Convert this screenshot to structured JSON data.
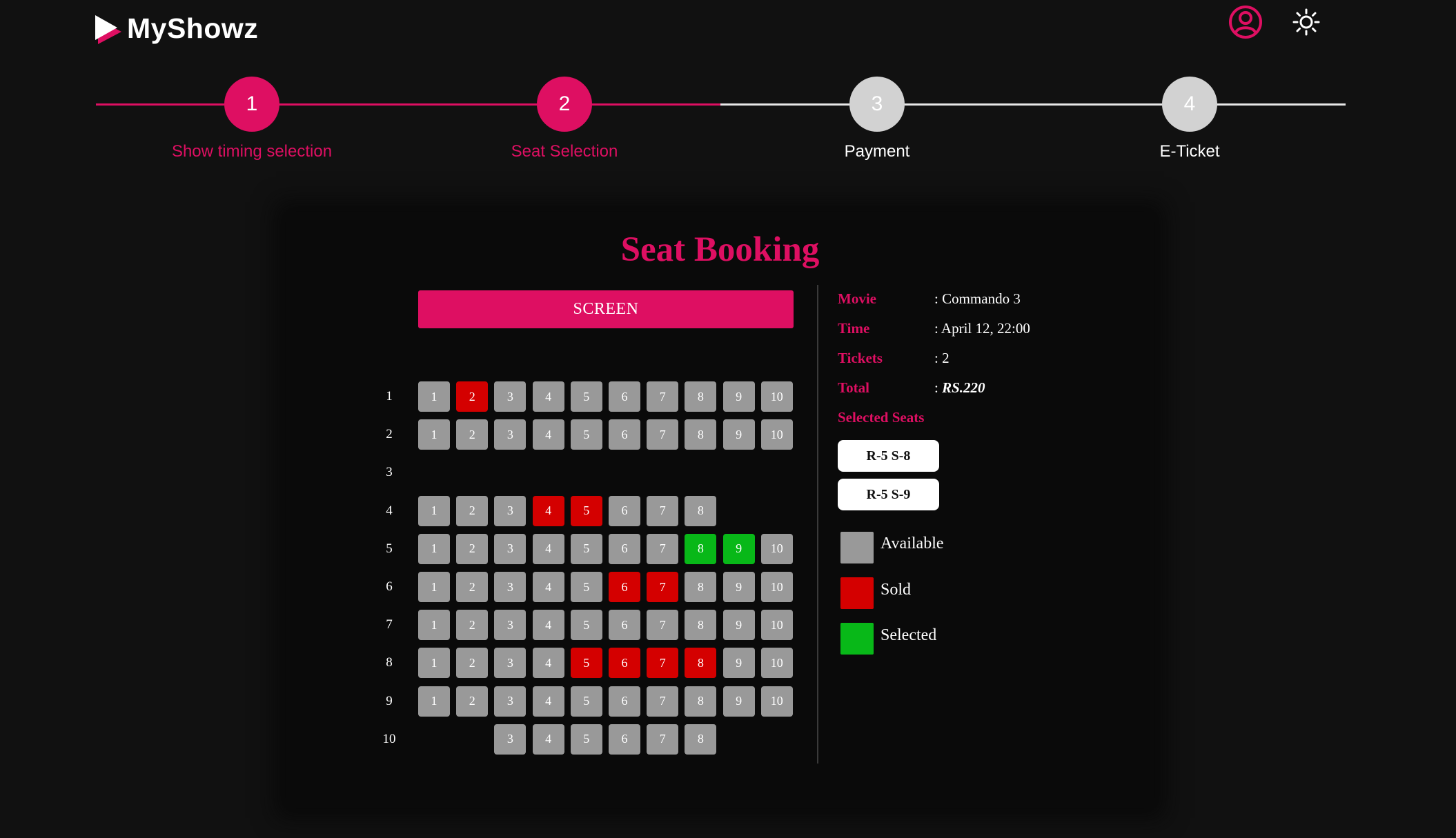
{
  "app": {
    "name": "MyShowz"
  },
  "colors": {
    "accent": "#de0f62",
    "available": "#999999",
    "sold": "#d40000",
    "selected": "#08b818",
    "background": "#111111"
  },
  "icons": {
    "logo": "play-triangle-icon",
    "user": "user-circle-icon",
    "theme": "sun-icon"
  },
  "steps": [
    {
      "number": "1",
      "label": "Show timing selection",
      "state": "complete"
    },
    {
      "number": "2",
      "label": "Seat Selection",
      "state": "current"
    },
    {
      "number": "3",
      "label": "Payment",
      "state": "pending"
    },
    {
      "number": "4",
      "label": "E-Ticket",
      "state": "pending"
    }
  ],
  "booking": {
    "title": "Seat Booking",
    "screen_label": "SCREEN",
    "rows": [
      {
        "label": "1",
        "seats": [
          {
            "n": "1",
            "status": "available"
          },
          {
            "n": "2",
            "status": "sold"
          },
          {
            "n": "3",
            "status": "available"
          },
          {
            "n": "4",
            "status": "available"
          },
          {
            "n": "5",
            "status": "available"
          },
          {
            "n": "6",
            "status": "available"
          },
          {
            "n": "7",
            "status": "available"
          },
          {
            "n": "8",
            "status": "available"
          },
          {
            "n": "9",
            "status": "available"
          },
          {
            "n": "10",
            "status": "available"
          }
        ]
      },
      {
        "label": "2",
        "seats": [
          {
            "n": "1",
            "status": "available"
          },
          {
            "n": "2",
            "status": "available"
          },
          {
            "n": "3",
            "status": "available"
          },
          {
            "n": "4",
            "status": "available"
          },
          {
            "n": "5",
            "status": "available"
          },
          {
            "n": "6",
            "status": "available"
          },
          {
            "n": "7",
            "status": "available"
          },
          {
            "n": "8",
            "status": "available"
          },
          {
            "n": "9",
            "status": "available"
          },
          {
            "n": "10",
            "status": "available"
          }
        ]
      },
      {
        "label": "3",
        "seats": []
      },
      {
        "label": "4",
        "seats": [
          {
            "n": "1",
            "status": "available"
          },
          {
            "n": "2",
            "status": "available"
          },
          {
            "n": "3",
            "status": "available"
          },
          {
            "n": "4",
            "status": "sold"
          },
          {
            "n": "5",
            "status": "sold"
          },
          {
            "n": "6",
            "status": "available"
          },
          {
            "n": "7",
            "status": "available"
          },
          {
            "n": "8",
            "status": "available"
          }
        ]
      },
      {
        "label": "5",
        "seats": [
          {
            "n": "1",
            "status": "available"
          },
          {
            "n": "2",
            "status": "available"
          },
          {
            "n": "3",
            "status": "available"
          },
          {
            "n": "4",
            "status": "available"
          },
          {
            "n": "5",
            "status": "available"
          },
          {
            "n": "6",
            "status": "available"
          },
          {
            "n": "7",
            "status": "available"
          },
          {
            "n": "8",
            "status": "selected"
          },
          {
            "n": "9",
            "status": "selected"
          },
          {
            "n": "10",
            "status": "available"
          }
        ]
      },
      {
        "label": "6",
        "seats": [
          {
            "n": "1",
            "status": "available"
          },
          {
            "n": "2",
            "status": "available"
          },
          {
            "n": "3",
            "status": "available"
          },
          {
            "n": "4",
            "status": "available"
          },
          {
            "n": "5",
            "status": "available"
          },
          {
            "n": "6",
            "status": "sold"
          },
          {
            "n": "7",
            "status": "sold"
          },
          {
            "n": "8",
            "status": "available"
          },
          {
            "n": "9",
            "status": "available"
          },
          {
            "n": "10",
            "status": "available"
          }
        ]
      },
      {
        "label": "7",
        "seats": [
          {
            "n": "1",
            "status": "available"
          },
          {
            "n": "2",
            "status": "available"
          },
          {
            "n": "3",
            "status": "available"
          },
          {
            "n": "4",
            "status": "available"
          },
          {
            "n": "5",
            "status": "available"
          },
          {
            "n": "6",
            "status": "available"
          },
          {
            "n": "7",
            "status": "available"
          },
          {
            "n": "8",
            "status": "available"
          },
          {
            "n": "9",
            "status": "available"
          },
          {
            "n": "10",
            "status": "available"
          }
        ]
      },
      {
        "label": "8",
        "seats": [
          {
            "n": "1",
            "status": "available"
          },
          {
            "n": "2",
            "status": "available"
          },
          {
            "n": "3",
            "status": "available"
          },
          {
            "n": "4",
            "status": "available"
          },
          {
            "n": "5",
            "status": "sold"
          },
          {
            "n": "6",
            "status": "sold"
          },
          {
            "n": "7",
            "status": "sold"
          },
          {
            "n": "8",
            "status": "sold"
          },
          {
            "n": "9",
            "status": "available"
          },
          {
            "n": "10",
            "status": "available"
          }
        ]
      },
      {
        "label": "9",
        "seats": [
          {
            "n": "1",
            "status": "available"
          },
          {
            "n": "2",
            "status": "available"
          },
          {
            "n": "3",
            "status": "available"
          },
          {
            "n": "4",
            "status": "available"
          },
          {
            "n": "5",
            "status": "available"
          },
          {
            "n": "6",
            "status": "available"
          },
          {
            "n": "7",
            "status": "available"
          },
          {
            "n": "8",
            "status": "available"
          },
          {
            "n": "9",
            "status": "available"
          },
          {
            "n": "10",
            "status": "available"
          }
        ]
      },
      {
        "label": "10",
        "seats": [
          {
            "n": "3",
            "status": "available"
          },
          {
            "n": "4",
            "status": "available"
          },
          {
            "n": "5",
            "status": "available"
          },
          {
            "n": "6",
            "status": "available"
          },
          {
            "n": "7",
            "status": "available"
          },
          {
            "n": "8",
            "status": "available"
          }
        ]
      }
    ]
  },
  "summary": {
    "movie_label": "Movie",
    "movie_value": ": Commando 3",
    "time_label": "Time",
    "time_value": ": April 12, 22:00",
    "tickets_label": "Tickets",
    "tickets_value": ": 2",
    "total_label": "Total",
    "total_prefix": ": ",
    "total_value": "RS.220",
    "selected_title": "Selected Seats",
    "selected_seats": [
      "R-5 S-8",
      "R-5 S-9"
    ]
  },
  "legend": [
    {
      "label": "Available",
      "status": "available"
    },
    {
      "label": "Sold",
      "status": "sold"
    },
    {
      "label": "Selected",
      "status": "selected"
    }
  ]
}
